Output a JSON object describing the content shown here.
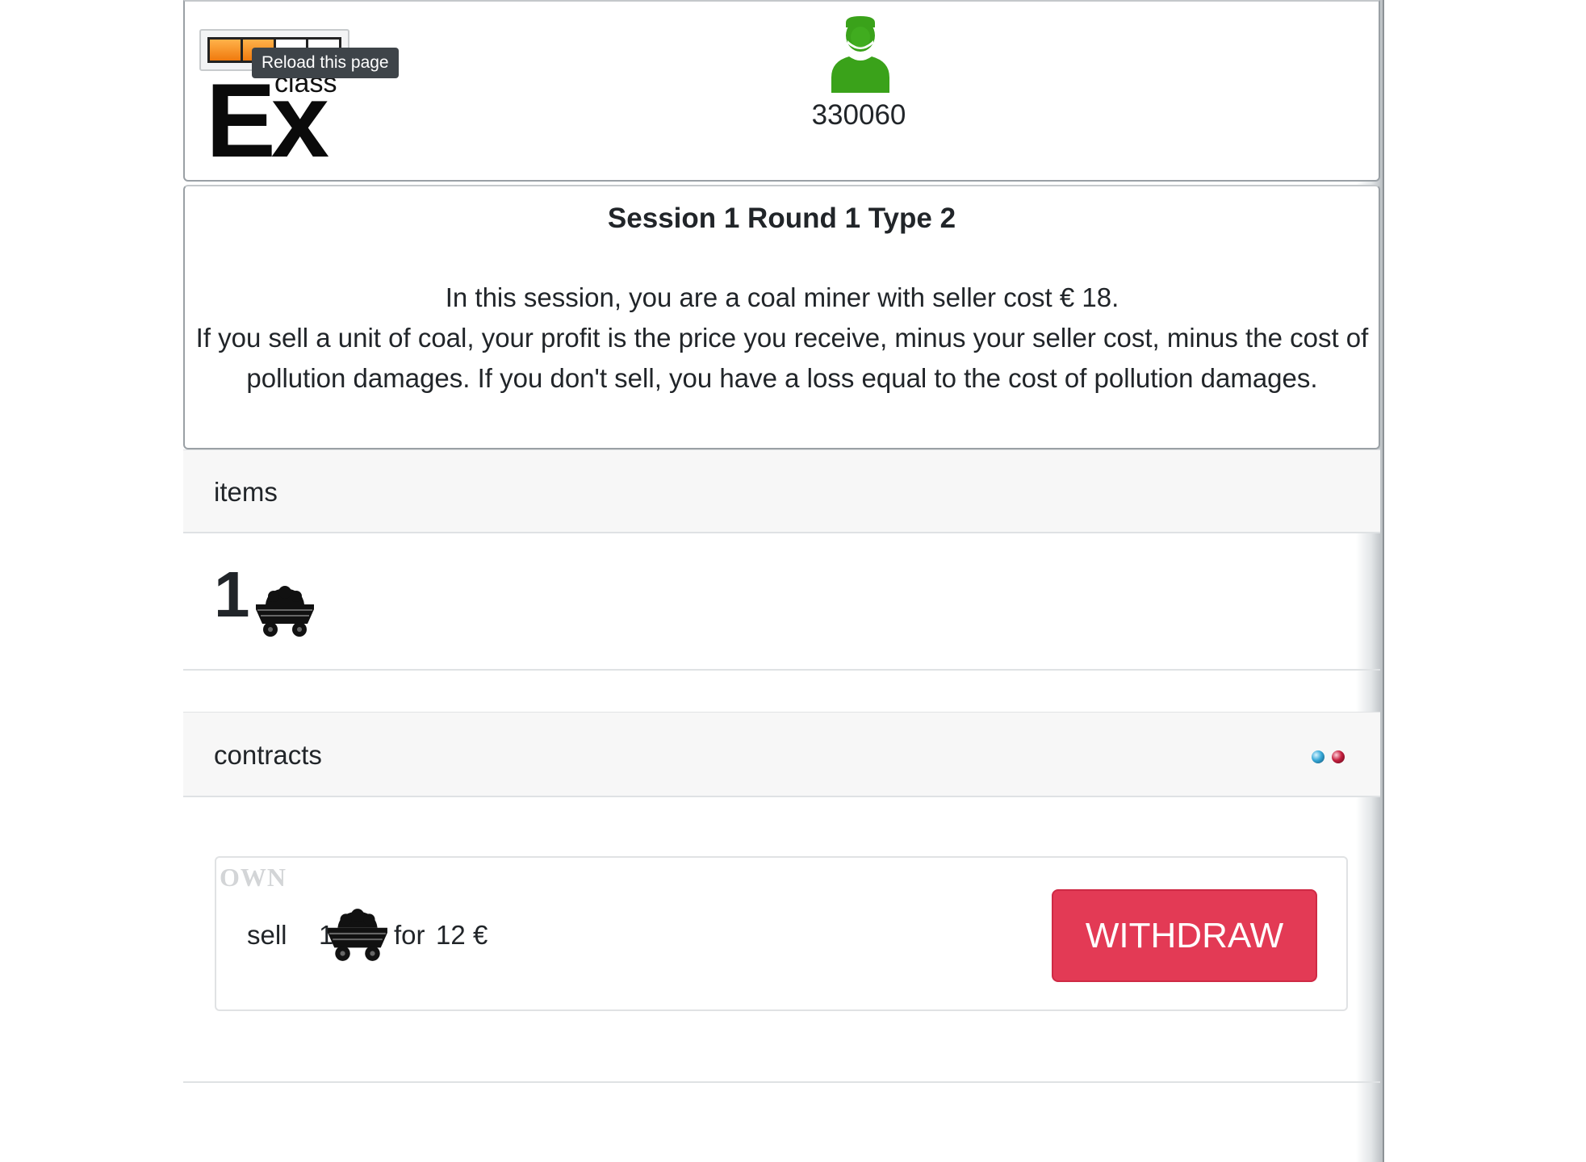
{
  "header": {
    "logo_text_small": "class",
    "logo_text_big": "Ex",
    "tooltip": "Reload this page",
    "logo_progress": 0.5,
    "user_icon": "user-silhouette-icon",
    "user_icon_color": "#3aa21a",
    "user_id": "330060"
  },
  "info": {
    "title": "Session 1 Round 1 Type 2",
    "line1": "In this session, you are a coal miner with seller cost € 18.",
    "line2": "If you sell a unit of coal, your profit is the price you receive, minus your seller cost, minus the cost of pollution damages. If you don't sell, you have a loss equal to the cost of pollution damages."
  },
  "items": {
    "label": "items",
    "count": "1",
    "icon": "coal-cart-icon"
  },
  "contracts": {
    "label": "contracts",
    "status_dots": [
      {
        "name": "status-dot-blue",
        "color": "#2b9fd0"
      },
      {
        "name": "status-dot-red",
        "color": "#c11d3c"
      }
    ],
    "offer": {
      "tag": "OWN",
      "action": "sell",
      "quantity": "1",
      "icon": "coal-cart-icon",
      "for_text": "for",
      "price": "12",
      "currency": "€",
      "button_label": "WITHDRAW",
      "button_color": "#e33a55"
    }
  }
}
